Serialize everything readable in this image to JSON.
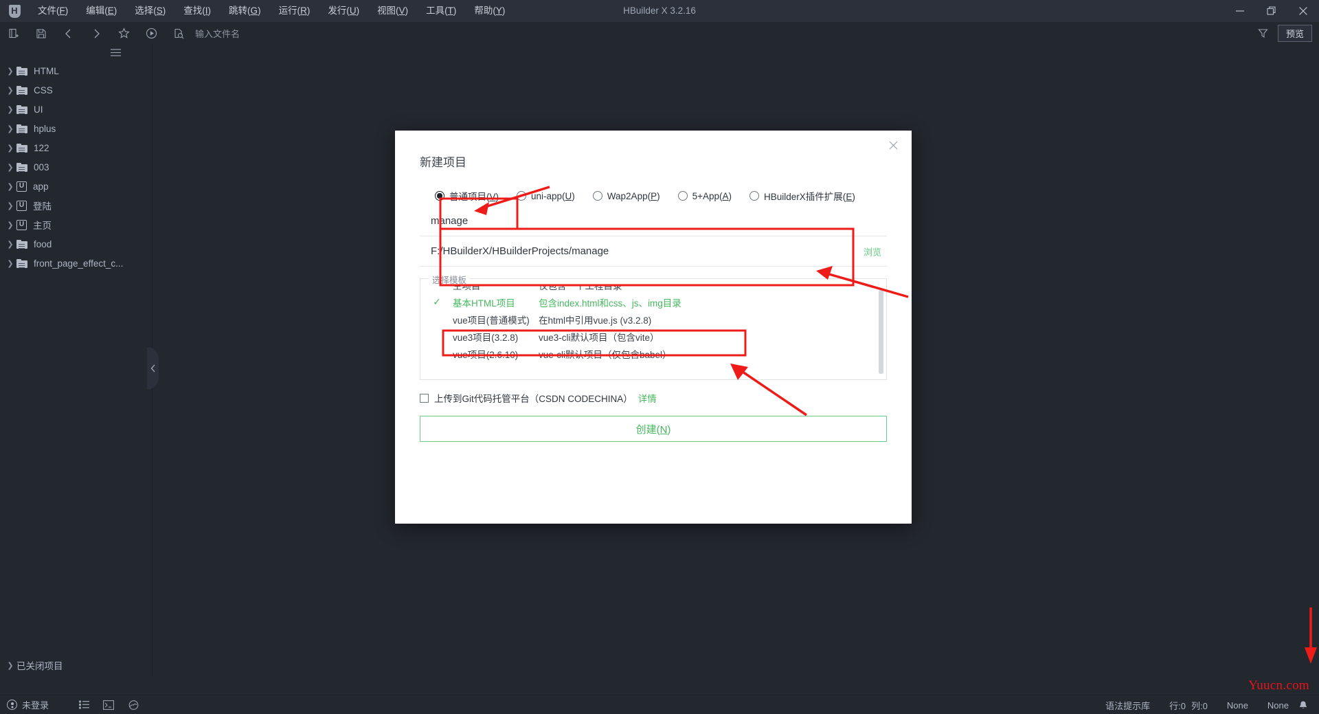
{
  "window": {
    "title": "HBuilder X 3.2.16",
    "logo_letter": "H",
    "minimize": "—",
    "restore": "❐",
    "close": "✕"
  },
  "menubar": {
    "items": [
      {
        "label": "文件(F)",
        "text": "文件(",
        "key": "F",
        "tail": ")"
      },
      {
        "label": "编辑(E)",
        "text": "编辑(",
        "key": "E",
        "tail": ")"
      },
      {
        "label": "选择(S)",
        "text": "选择(",
        "key": "S",
        "tail": ")"
      },
      {
        "label": "查找(I)",
        "text": "查找(",
        "key": "I",
        "tail": ")"
      },
      {
        "label": "跳转(G)",
        "text": "跳转(",
        "key": "G",
        "tail": ")"
      },
      {
        "label": "运行(R)",
        "text": "运行(",
        "key": "R",
        "tail": ")"
      },
      {
        "label": "发行(U)",
        "text": "发行(",
        "key": "U",
        "tail": ")"
      },
      {
        "label": "视图(V)",
        "text": "视图(",
        "key": "V",
        "tail": ")"
      },
      {
        "label": "工具(T)",
        "text": "工具(",
        "key": "T",
        "tail": ")"
      },
      {
        "label": "帮助(Y)",
        "text": "帮助(",
        "key": "Y",
        "tail": ")"
      }
    ]
  },
  "toolbar": {
    "filename_placeholder": "输入文件名",
    "preview_label": "预览",
    "icons": [
      "new-file-icon",
      "save-icon",
      "back-icon",
      "forward-icon",
      "favorite-icon",
      "run-icon",
      "find-file-icon"
    ]
  },
  "sidebar": {
    "tree": [
      {
        "label": "HTML",
        "icon": "folder-icon"
      },
      {
        "label": "CSS",
        "icon": "folder-icon"
      },
      {
        "label": "UI",
        "icon": "folder-icon"
      },
      {
        "label": "hplus",
        "icon": "folder-icon"
      },
      {
        "label": "122",
        "icon": "folder-icon"
      },
      {
        "label": "003",
        "icon": "folder-icon"
      },
      {
        "label": "app",
        "icon": "uniapp-icon"
      },
      {
        "label": "登陆",
        "icon": "uniapp-icon"
      },
      {
        "label": "主页",
        "icon": "uniapp-icon"
      },
      {
        "label": "food",
        "icon": "folder-icon"
      },
      {
        "label": "front_page_effect_c...",
        "icon": "folder-icon"
      }
    ],
    "closed_projects": "已关闭项目",
    "uniapp_badge": "U"
  },
  "statusbar": {
    "account": "未登录",
    "syntax_library": "语法提示库",
    "line": "行:0",
    "column": "列:0",
    "encoding": "None",
    "language": "None",
    "watermark": "Yuucn.com"
  },
  "dialog": {
    "title": "新建项目",
    "close": "✕",
    "project_types": [
      {
        "label_text": "普通项目(",
        "key": "V",
        "tail": ")",
        "checked": true
      },
      {
        "label_text": "uni-app(",
        "key": "U",
        "tail": ")",
        "checked": false
      },
      {
        "label_text": "Wap2App(",
        "key": "P",
        "tail": ")",
        "checked": false
      },
      {
        "label_text": "5+App(",
        "key": "A",
        "tail": ")",
        "checked": false
      },
      {
        "label_text": "HBuilderX插件扩展(",
        "key": "E",
        "tail": ")",
        "checked": false
      }
    ],
    "project_name": "manage",
    "project_path": "F:/HBuilderX/HBuilderProjects/manage",
    "browse_label": "浏览",
    "template_legend": "选择模板",
    "templates": [
      {
        "name": "空项目",
        "desc": "仅包含一个工程目录",
        "selected": false,
        "check": ""
      },
      {
        "name": "基本HTML项目",
        "desc": "包含index.html和css、js、img目录",
        "selected": true,
        "check": "✓"
      },
      {
        "name": "vue项目(普通模式)",
        "desc": "在html中引用vue.js (v3.2.8)",
        "selected": false,
        "check": ""
      },
      {
        "name": "vue3项目(3.2.8)",
        "desc": "vue3-cli默认项目（包含vite）",
        "selected": false,
        "check": ""
      },
      {
        "name": "vue项目(2.6.10)",
        "desc": "vue-cli默认项目（仅包含babel）",
        "selected": false,
        "check": ""
      }
    ],
    "git_checkbox_label": "上传到Git代码托管平台（CSDN CODECHINA）",
    "git_detail_link": "详情",
    "create_button_text": "创建(",
    "create_button_key": "N",
    "create_button_tail": ")"
  },
  "colors": {
    "accent_green": "#45b85f",
    "annotation_red": "#ee1c18",
    "chrome_dark": "#23272e",
    "titlebar": "#2b303b",
    "watermark_red": "#e8131b"
  }
}
